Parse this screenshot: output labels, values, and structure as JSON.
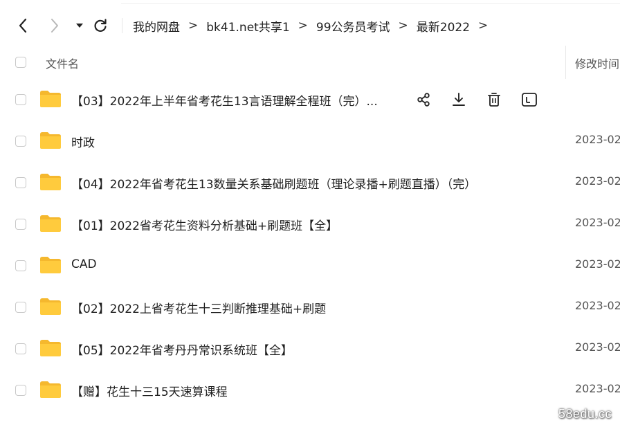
{
  "toolbar": {
    "breadcrumb": [
      {
        "label": "我的网盘"
      },
      {
        "label": "bk41.net共享1"
      },
      {
        "label": "99公务员考试"
      },
      {
        "label": "最新2022"
      }
    ],
    "separator": ">"
  },
  "table": {
    "name_header": "文件名",
    "mtime_header": "修改时间",
    "rows": [
      {
        "name": "【03】2022年上半年省考花生13言语理解全程班（完）...",
        "mtime": "",
        "type": "folder",
        "hovered": true
      },
      {
        "name": "时政",
        "mtime": "2023-02",
        "type": "folder"
      },
      {
        "name": "【04】2022年省考花生13数量关系基础刷题班（理论录播+刷题直播）（完）",
        "mtime": "2023-02",
        "type": "folder"
      },
      {
        "name": "【01】2022省考花生资料分析基础+刷题班【全】",
        "mtime": "2023-02",
        "type": "folder"
      },
      {
        "name": "CAD",
        "mtime": "2023-02",
        "type": "folder"
      },
      {
        "name": "【02】2022上省考花生十三判断推理基础+刷题",
        "mtime": "2023-02",
        "type": "folder"
      },
      {
        "name": "【05】2022年省考丹丹常识系统班【全】",
        "mtime": "2023-02",
        "type": "folder"
      },
      {
        "name": "【赠】花生十三15天速算课程",
        "mtime": "2023-02",
        "type": "folder"
      }
    ],
    "row_actions": [
      "share-icon",
      "download-icon",
      "delete-icon",
      "more-icon"
    ]
  },
  "watermark": {
    "text": "58edu.cc"
  },
  "colors": {
    "folder": "#FFCB3D",
    "folder_tab": "#F5B82E",
    "text": "#1f1f1f",
    "muted": "#555555",
    "border": "#c9c9c9"
  }
}
